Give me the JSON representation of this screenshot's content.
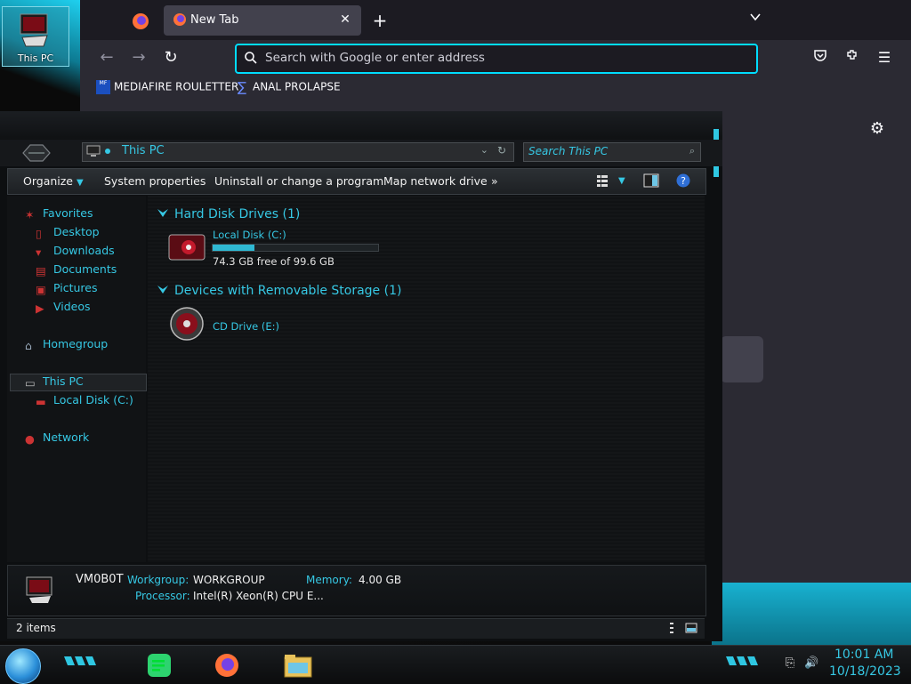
{
  "desktop": {
    "icon_label": "This PC"
  },
  "firefox": {
    "tab_title": "New Tab",
    "urlbar_placeholder": "Search with Google or enter address",
    "bookmarks": [
      {
        "label": "MEDIAFIRE ROULETTER",
        "icon": "mediafire-icon"
      },
      {
        "label": "ANAL PROLAPSE",
        "icon": "sigma-icon"
      }
    ],
    "accent": "#00ddff"
  },
  "explorer": {
    "address": "This PC",
    "search_placeholder": "Search This PC",
    "toolbar": {
      "organize": "Organize",
      "system_properties": "System properties",
      "uninstall": "Uninstall or change a program",
      "map_drive": "Map network drive",
      "more": "»"
    },
    "nav": {
      "favorites": "Favorites",
      "desktop": "Desktop",
      "downloads": "Downloads",
      "documents": "Documents",
      "pictures": "Pictures",
      "videos": "Videos",
      "homegroup": "Homegroup",
      "this_pc": "This PC",
      "local_disk": "Local Disk (C:)",
      "network": "Network"
    },
    "groups": {
      "hdd": "Hard Disk Drives (1)",
      "removable": "Devices with Removable Storage (1)"
    },
    "drives": {
      "c_name": "Local Disk (C:)",
      "c_free": "74.3 GB free of 99.6 GB",
      "c_used_fraction": 0.254,
      "e_name": "CD Drive (E:)"
    },
    "details": {
      "computer_name": "VM0B0T",
      "workgroup_label": "Workgroup:",
      "workgroup_value": "WORKGROUP",
      "memory_label": "Memory:",
      "memory_value": "4.00 GB",
      "processor_label": "Processor:",
      "processor_value": "Intel(R) Xeon(R) CPU E..."
    },
    "status": "2 items",
    "accent": "#36c8e4"
  },
  "taskbar": {
    "time": "10:01 AM",
    "date": "10/18/2023"
  }
}
